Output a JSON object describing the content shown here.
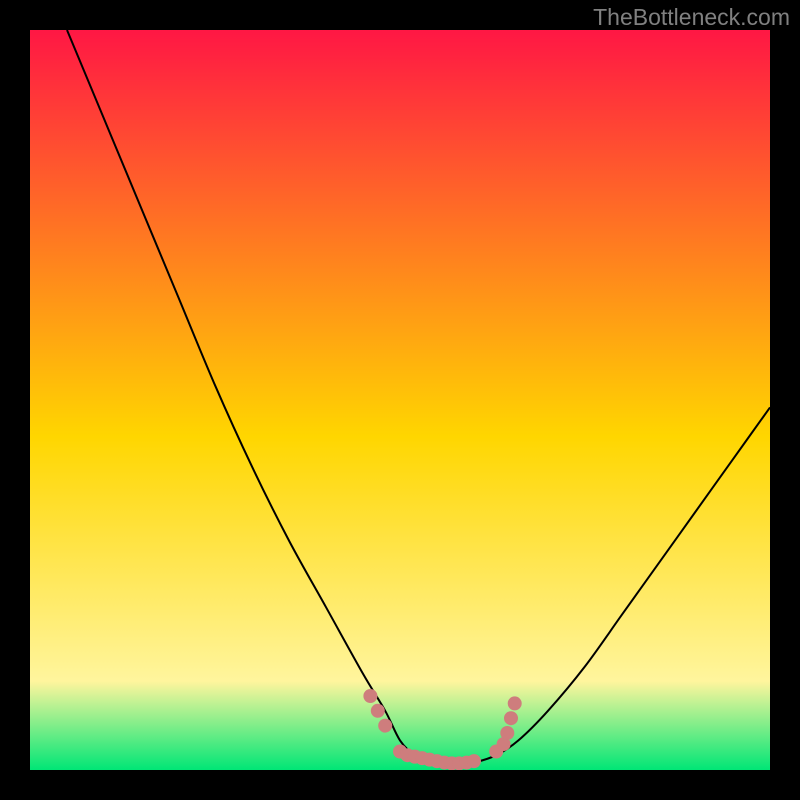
{
  "watermark": "TheBottleneck.com",
  "gradient": {
    "top": "#ff1744",
    "mid1": "#ffd600",
    "mid2": "#fff59d",
    "bottom": "#00e676"
  },
  "curve_stroke": "#000000",
  "marker_color": "#ce7d7d",
  "chart_data": {
    "type": "line",
    "title": "",
    "xlabel": "",
    "ylabel": "",
    "xlim": [
      0,
      100
    ],
    "ylim": [
      0,
      100
    ],
    "series": [
      {
        "name": "bottleneck-curve",
        "x": [
          5,
          10,
          15,
          20,
          25,
          30,
          35,
          40,
          45,
          48,
          50,
          52,
          54,
          56,
          58,
          60,
          63,
          66,
          70,
          75,
          80,
          85,
          90,
          95,
          100
        ],
        "values": [
          100,
          88,
          76,
          64,
          52,
          41,
          31,
          22,
          13,
          8,
          4,
          2,
          1,
          0.8,
          0.8,
          1,
          2,
          4,
          8,
          14,
          21,
          28,
          35,
          42,
          49
        ]
      }
    ],
    "markers": [
      {
        "x": 46,
        "y": 10
      },
      {
        "x": 47,
        "y": 8
      },
      {
        "x": 48,
        "y": 6
      },
      {
        "x": 50,
        "y": 2.5
      },
      {
        "x": 51,
        "y": 2
      },
      {
        "x": 52,
        "y": 1.8
      },
      {
        "x": 53,
        "y": 1.6
      },
      {
        "x": 54,
        "y": 1.4
      },
      {
        "x": 55,
        "y": 1.2
      },
      {
        "x": 56,
        "y": 1.0
      },
      {
        "x": 57,
        "y": 0.9
      },
      {
        "x": 58,
        "y": 0.9
      },
      {
        "x": 59,
        "y": 1.0
      },
      {
        "x": 60,
        "y": 1.2
      },
      {
        "x": 63,
        "y": 2.5
      },
      {
        "x": 64,
        "y": 3.5
      },
      {
        "x": 64.5,
        "y": 5
      },
      {
        "x": 65,
        "y": 7
      },
      {
        "x": 65.5,
        "y": 9
      }
    ]
  }
}
